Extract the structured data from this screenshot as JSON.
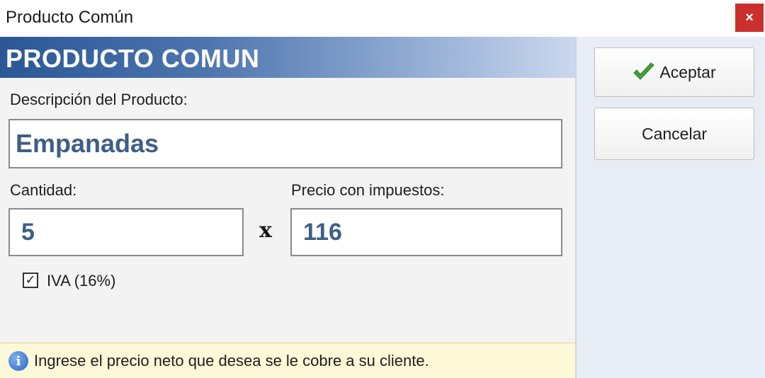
{
  "window": {
    "title": "Producto Común",
    "close_label": "×"
  },
  "header": {
    "title": "PRODUCTO COMUN"
  },
  "form": {
    "description_label": "Descripción del Producto:",
    "description_value": "Empanadas",
    "quantity_label": "Cantidad:",
    "quantity_value": "5",
    "multiply_sign": "x",
    "price_label": "Precio con impuestos:",
    "price_value": "116",
    "iva_label": "IVA (16%)",
    "iva_checked": true
  },
  "info": {
    "icon": "info-icon",
    "message": "Ingrese el precio neto que desea se le cobre a su cliente."
  },
  "buttons": {
    "accept_label": "Aceptar",
    "cancel_label": "Cancelar"
  },
  "colors": {
    "header_start": "#2b5797",
    "input_text": "#3e5e86",
    "close_bg": "#c9302c",
    "info_bg": "#fdf9d8"
  }
}
